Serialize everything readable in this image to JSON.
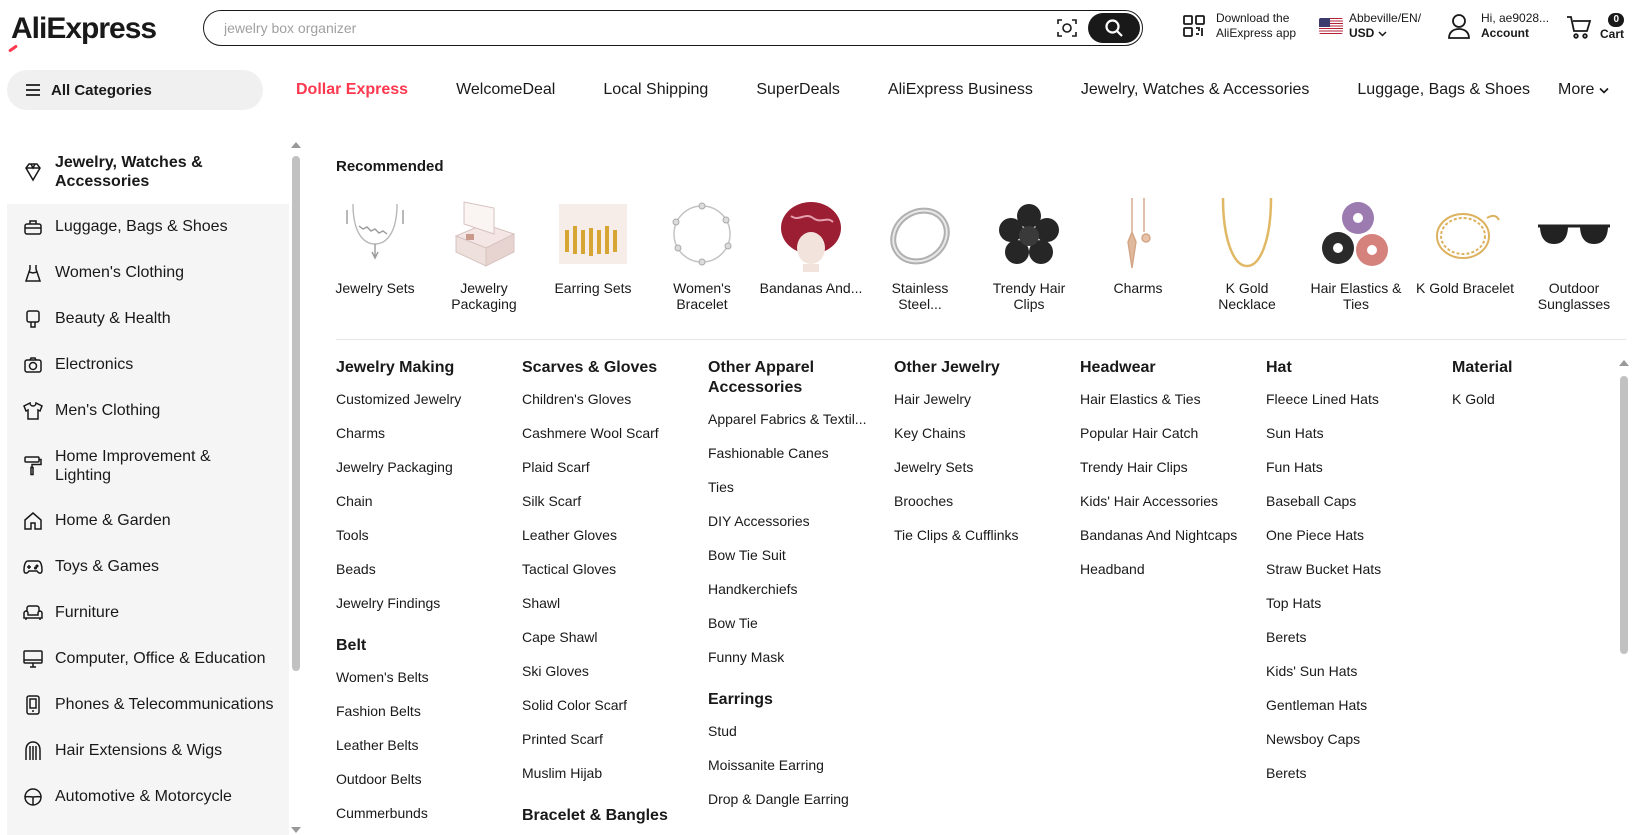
{
  "header": {
    "logo_text": "AliExpress",
    "search_placeholder": "jewelry box organizer",
    "app_download_line1": "Download the",
    "app_download_line2": "AliExpress app",
    "locale_line1": "Abbeville/EN/",
    "locale_line2": "USD",
    "account_line1": "Hi, ae9028...",
    "account_line2": "Account",
    "cart_count": "0",
    "cart_label": "Cart"
  },
  "nav": {
    "all_categories": "All Categories",
    "links": [
      "Dollar Express",
      "WelcomeDeal",
      "Local Shipping",
      "SuperDeals",
      "AliExpress Business",
      "Jewelry, Watches & Accessories",
      "Luggage, Bags & Shoes"
    ],
    "more": "More"
  },
  "sidebar": {
    "items": [
      {
        "label": "Jewelry, Watches & Accessories",
        "icon": "jewelry-icon"
      },
      {
        "label": "Luggage, Bags & Shoes",
        "icon": "luggage-icon"
      },
      {
        "label": "Women's Clothing",
        "icon": "dress-icon"
      },
      {
        "label": "Beauty & Health",
        "icon": "beauty-icon"
      },
      {
        "label": "Electronics",
        "icon": "camera-icon"
      },
      {
        "label": "Men's Clothing",
        "icon": "shirt-icon"
      },
      {
        "label": "Home Improvement & Lighting",
        "icon": "paint-roller-icon"
      },
      {
        "label": "Home & Garden",
        "icon": "house-icon"
      },
      {
        "label": "Toys & Games",
        "icon": "gamepad-icon"
      },
      {
        "label": "Furniture",
        "icon": "sofa-icon"
      },
      {
        "label": "Computer, Office & Education",
        "icon": "monitor-icon"
      },
      {
        "label": "Phones & Telecommunications",
        "icon": "phone-icon"
      },
      {
        "label": "Hair Extensions & Wigs",
        "icon": "hair-icon"
      },
      {
        "label": "Automotive & Motorcycle",
        "icon": "steering-icon"
      }
    ]
  },
  "recommended": {
    "title": "Recommended",
    "items": [
      {
        "label": "Jewelry Sets"
      },
      {
        "label": "Jewelry Packaging"
      },
      {
        "label": "Earring Sets"
      },
      {
        "label": "Women's Bracelet"
      },
      {
        "label": "Bandanas And..."
      },
      {
        "label": "Stainless Steel..."
      },
      {
        "label": "Trendy Hair Clips"
      },
      {
        "label": "Charms"
      },
      {
        "label": "K Gold Necklace"
      },
      {
        "label": "Hair Elastics & Ties"
      },
      {
        "label": "K Gold Bracelet"
      },
      {
        "label": "Outdoor Sunglasses"
      }
    ]
  },
  "columns": [
    {
      "groups": [
        {
          "title": "Jewelry Making",
          "links": [
            "Customized Jewelry",
            "Charms",
            "Jewelry Packaging",
            "Chain",
            "Tools",
            "Beads",
            "Jewelry Findings"
          ]
        },
        {
          "title": "Belt",
          "links": [
            "Women's Belts",
            "Fashion Belts",
            "Leather Belts",
            "Outdoor Belts",
            "Cummerbunds"
          ]
        }
      ]
    },
    {
      "groups": [
        {
          "title": "Scarves & Gloves",
          "links": [
            "Children's Gloves",
            "Cashmere Wool Scarf",
            "Plaid Scarf",
            "Silk Scarf",
            "Leather Gloves",
            "Tactical Gloves",
            "Shawl",
            "Cape Shawl",
            "Ski Gloves",
            "Solid Color Scarf",
            "Printed Scarf",
            "Muslim Hijab"
          ]
        },
        {
          "title": "Bracelet & Bangles",
          "links": []
        }
      ]
    },
    {
      "groups": [
        {
          "title": "Other Apparel Accessories",
          "links": [
            "Apparel Fabrics & Textil...",
            "Fashionable Canes",
            "Ties",
            "DIY Accessories",
            "Bow Tie Suit",
            "Handkerchiefs",
            "Bow Tie",
            "Funny Mask"
          ]
        },
        {
          "title": "Earrings",
          "links": [
            "Stud",
            "Moissanite Earring",
            "Drop & Dangle Earring"
          ]
        }
      ]
    },
    {
      "groups": [
        {
          "title": "Other Jewelry",
          "links": [
            "Hair Jewelry",
            "Key Chains",
            "Jewelry Sets",
            "Brooches",
            "Tie Clips & Cufflinks"
          ]
        }
      ]
    },
    {
      "groups": [
        {
          "title": "Headwear",
          "links": [
            "Hair Elastics & Ties",
            "Popular Hair Catch",
            "Trendy Hair Clips",
            "Kids' Hair Accessories",
            "Bandanas And Nightcaps",
            "Headband"
          ]
        }
      ]
    },
    {
      "groups": [
        {
          "title": "Hat",
          "links": [
            "Fleece Lined Hats",
            "Sun Hats",
            "Fun Hats",
            "Baseball Caps",
            "One Piece Hats",
            "Straw Bucket Hats",
            "Top Hats",
            "Berets",
            "Kids' Sun Hats",
            "Gentleman Hats",
            "Newsboy Caps",
            "Berets"
          ]
        }
      ]
    },
    {
      "groups": [
        {
          "title": "Material",
          "links": [
            "K Gold"
          ]
        }
      ]
    }
  ]
}
